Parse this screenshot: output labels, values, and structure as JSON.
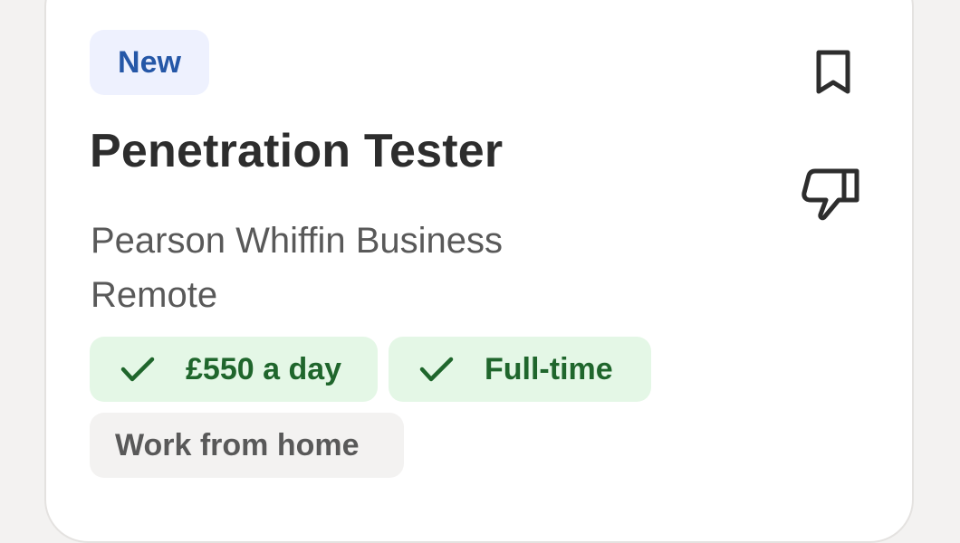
{
  "job": {
    "badge": "New",
    "title": "Penetration Tester",
    "company": "Pearson Whiffin Business",
    "location": "Remote",
    "tags": [
      {
        "label": "£550 a day",
        "style": "green",
        "icon": "check-icon"
      },
      {
        "label": "Full-time",
        "style": "green",
        "icon": "check-icon"
      },
      {
        "label": "Work from home",
        "style": "grey"
      }
    ]
  },
  "actions": {
    "save_icon": "bookmark-icon",
    "dislike_icon": "thumbs-down-icon"
  },
  "colors": {
    "badge_bg": "#eef1fe",
    "badge_text": "#2557a7",
    "tag_green_bg": "#e4f7e6",
    "tag_green_text": "#1f662c",
    "tag_grey_bg": "#f3f2f1",
    "tag_grey_text": "#595959",
    "title_text": "#2d2d2d"
  }
}
